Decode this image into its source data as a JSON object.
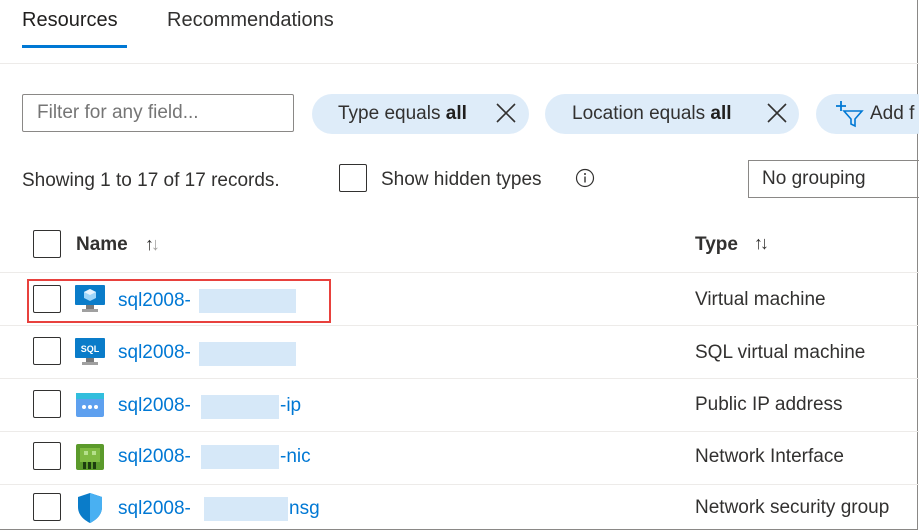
{
  "tabs": [
    {
      "label": "Resources",
      "active": true
    },
    {
      "label": "Recommendations",
      "active": false
    }
  ],
  "filter": {
    "placeholder": "Filter for any field..."
  },
  "pills": [
    {
      "prefix": "Type equals ",
      "value": "all"
    },
    {
      "prefix": "Location equals ",
      "value": "all"
    },
    {
      "label": "Add f"
    }
  ],
  "records_text": "Showing 1 to 17 of 17 records.",
  "show_hidden_label": "Show hidden types",
  "grouping": "No grouping",
  "columns": {
    "name": "Name",
    "type": "Type"
  },
  "rows": [
    {
      "name_prefix": "sql2008-",
      "name_suffix": "",
      "type": "Virtual machine",
      "icon": "virtual-machine-icon",
      "highlighted": true
    },
    {
      "name_prefix": "sql2008-",
      "name_suffix": "",
      "type": "SQL virtual machine",
      "icon": "sql-virtual-machine-icon",
      "highlighted": false
    },
    {
      "name_prefix": "sql2008-",
      "name_suffix": "-ip",
      "type": "Public IP address",
      "icon": "public-ip-icon",
      "highlighted": false
    },
    {
      "name_prefix": "sql2008-",
      "name_suffix": "-nic",
      "type": "Network Interface",
      "icon": "network-interface-icon",
      "highlighted": false
    },
    {
      "name_prefix": "sql2008-",
      "name_suffix": "nsg",
      "type": "Network security group",
      "icon": "network-security-group-icon",
      "highlighted": false
    }
  ],
  "colors": {
    "accent": "#0078d4",
    "pill_bg": "#deecf9",
    "highlight": "#e8413d"
  }
}
